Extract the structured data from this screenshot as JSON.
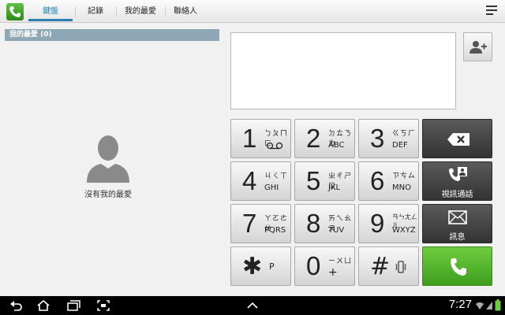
{
  "tabs": [
    {
      "label": "鍵盤",
      "active": true
    },
    {
      "label": "記錄"
    },
    {
      "label": "我的最愛"
    },
    {
      "label": "聯絡人"
    }
  ],
  "favorites": {
    "header": "我的最愛 (0)",
    "empty_text": "沒有我的最愛"
  },
  "keypad": {
    "k1": {
      "digit": "1",
      "zhuyin": "ㄅㄆㄇㄈ",
      "letters": "ꝎꝎ"
    },
    "k2": {
      "digit": "2",
      "zhuyin": "ㄉㄊㄋㄌ",
      "letters": "ABC"
    },
    "k3": {
      "digit": "3",
      "zhuyin": "ㄍㄎㄏ",
      "letters": "DEF"
    },
    "k4": {
      "digit": "4",
      "zhuyin": "ㄐㄑㄒ",
      "letters": "GHI"
    },
    "k5": {
      "digit": "5",
      "zhuyin": "ㄓㄔㄕㄖ",
      "letters": "JKL"
    },
    "k6": {
      "digit": "6",
      "zhuyin": "ㄗㄘㄙ",
      "letters": "MNO"
    },
    "k7": {
      "digit": "7",
      "zhuyin": "ㄚㄛㄜㄝ",
      "letters": "PQRS"
    },
    "k8": {
      "digit": "8",
      "zhuyin": "ㄞㄟㄠㄡ",
      "letters": "TUV"
    },
    "k9": {
      "digit": "9",
      "zhuyin": "ㄢㄣㄤㄥㄦ",
      "letters": "WXYZ"
    },
    "kstar": {
      "symbol": "✱",
      "sub": "P"
    },
    "k0": {
      "digit": "0",
      "zhuyin": "ㄧㄨㄩ",
      "sub": "+"
    },
    "khash": {
      "symbol": "#"
    }
  },
  "functions": {
    "video_call": "視訊通話",
    "message": "訊息"
  },
  "status": {
    "time": "7:27"
  },
  "colors": {
    "accent": "#2a7fb0",
    "call_green": "#4fb52a",
    "favorites_header": "#8fa6b5"
  }
}
